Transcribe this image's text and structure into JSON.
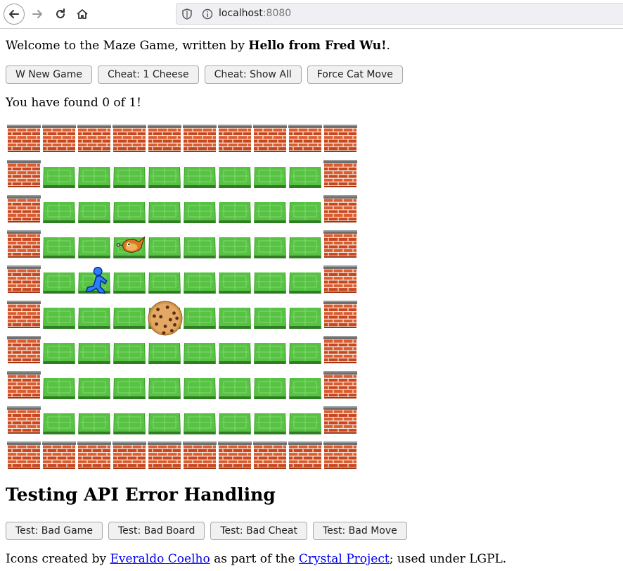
{
  "browser": {
    "url_host": "localhost",
    "url_port": ":8080"
  },
  "page": {
    "welcome_prefix": "Welcome to the Maze Game, written by ",
    "author": "Hello from Fred Wu!",
    "welcome_suffix": ".",
    "buttons": {
      "new_game": "W New Game",
      "cheat_cheese": "Cheat: 1 Cheese",
      "cheat_show_all": "Cheat: Show All",
      "force_cat_move": "Force Cat Move"
    },
    "found_text": "You have found 0 of 1!"
  },
  "maze": {
    "rows": 10,
    "cols": 10,
    "layout": [
      "WWWWWWWWWW",
      "WFFFFFFFFW",
      "WFFFFFFFFW",
      "WFFCFFFFFW",
      "WFPFFFFFFW",
      "WFFFKFFFFW",
      "WFFFFFFFFW",
      "WFFFFFFFFW",
      "WFFFFFFFFW",
      "WWWWWWWWWW"
    ],
    "legend": {
      "W": "brick-wall",
      "F": "grass-floor",
      "C": "cat",
      "P": "player-runner",
      "K": "cookie-cheese"
    }
  },
  "api_section": {
    "heading": "Testing API Error Handling",
    "buttons": {
      "bad_game": "Test: Bad Game",
      "bad_board": "Test: Bad Board",
      "bad_cheat": "Test: Bad Cheat",
      "bad_move": "Test: Bad Move"
    }
  },
  "credits": {
    "prefix": "Icons created by ",
    "author_link": "Everaldo Coelho",
    "middle": " as part of the ",
    "project_link": "Crystal Project",
    "suffix": "; used under LGPL."
  },
  "colors": {
    "brick": "#d2532a",
    "grass": "#4cb93a",
    "link": "#0000ee"
  }
}
